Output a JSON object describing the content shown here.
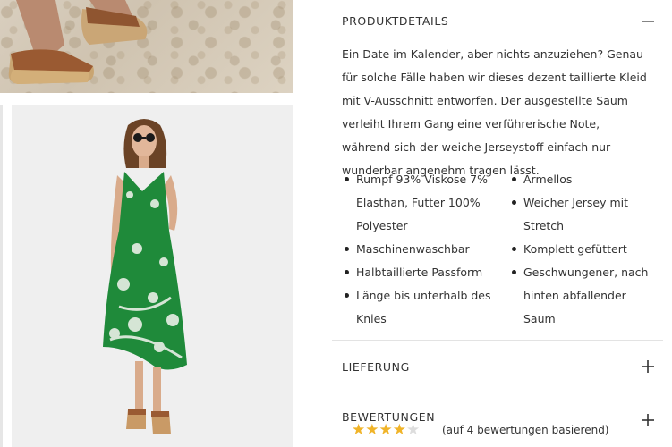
{
  "details": {
    "title": "PRODUKTDETAILS",
    "description": "Ein Date im Kalender, aber nichts anzuziehen? Genau für solche Fälle haben wir dieses dezent taillierte Kleid mit V-Ausschnitt entworfen. Der ausgestellte Saum verleiht Ihrem Gang eine verführerische Note, während sich der weiche Jerseystoff einfach nur wunderbar angenehm tragen lässt.",
    "features_left": [
      "Rumpf 93% Viskose 7% Elasthan, Futter 100% Polyester",
      "Maschinenwaschbar",
      "Halbtaillierte Passform",
      "Länge bis unterhalb des Knies"
    ],
    "features_right": [
      "Ärmellos",
      "Weicher Jersey mit Stretch",
      "Komplett gefüttert",
      "Geschwungener, nach hinten abfallender Saum"
    ]
  },
  "delivery": {
    "title": "LIEFERUNG"
  },
  "reviews": {
    "title": "BEWERTUNGEN",
    "rating": 4,
    "max_rating": 5,
    "count_text": "(auf 4 bewertungen basierend)"
  },
  "colors": {
    "dress_green": "#1f8a3a",
    "star_filled": "#f0b429",
    "star_empty": "#dddddd"
  }
}
